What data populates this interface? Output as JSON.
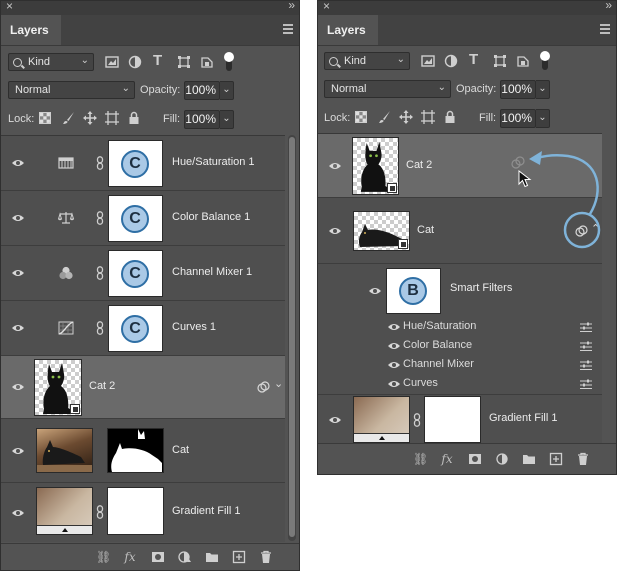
{
  "left_panel": {
    "tab_title": "Layers",
    "filter_kind": "Kind",
    "blend_mode": "Normal",
    "opacity_label": "Opacity:",
    "opacity_value": "100%",
    "lock_label": "Lock:",
    "fill_label": "Fill:",
    "fill_value": "100%",
    "layers": [
      {
        "name": "Hue/Saturation 1",
        "badge": "C",
        "icon": "hue-saturation-icon"
      },
      {
        "name": "Color Balance 1",
        "badge": "C",
        "icon": "color-balance-icon"
      },
      {
        "name": "Channel Mixer 1",
        "badge": "C",
        "icon": "channel-mixer-icon"
      },
      {
        "name": "Curves 1",
        "badge": "C",
        "icon": "curves-icon"
      },
      {
        "name": "Cat 2"
      },
      {
        "name": "Cat"
      },
      {
        "name": "Gradient Fill 1"
      }
    ]
  },
  "right_panel": {
    "tab_title": "Layers",
    "filter_kind": "Kind",
    "blend_mode": "Normal",
    "opacity_label": "Opacity:",
    "opacity_value": "100%",
    "lock_label": "Lock:",
    "fill_label": "Fill:",
    "fill_value": "100%",
    "layers": {
      "cat2": "Cat 2",
      "cat": "Cat",
      "smart_filters": "Smart Filters",
      "smart_badge": "B",
      "filters": [
        "Hue/Saturation",
        "Color Balance",
        "Channel Mixer",
        "Curves"
      ],
      "gradient": "Gradient Fill 1"
    }
  },
  "colors": {
    "panel": "#535353",
    "selected_row": "#6a6a6a",
    "badge_fill": "#aac9e6",
    "badge_ring": "#2f6fa5",
    "arrow": "#7fb3d9"
  }
}
